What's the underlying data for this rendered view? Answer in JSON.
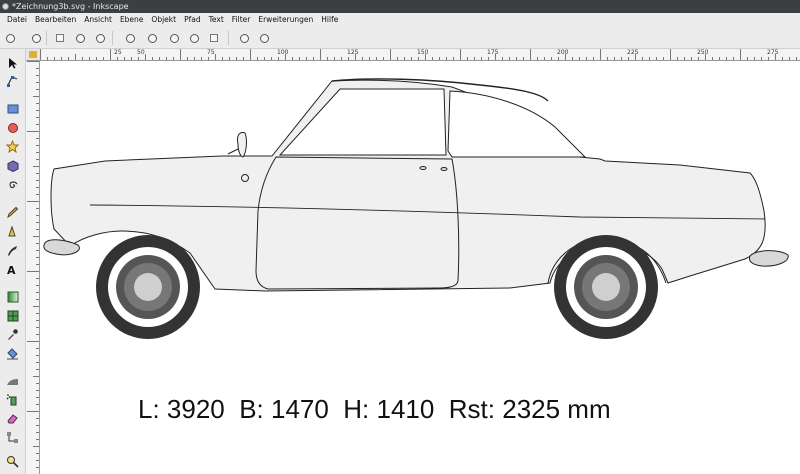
{
  "window": {
    "title": "*Zeichnung3b.svg - Inkscape"
  },
  "menu": {
    "items": [
      {
        "id": "datei",
        "label": "Datei"
      },
      {
        "id": "bearbeiten",
        "label": "Bearbeiten"
      },
      {
        "id": "ansicht",
        "label": "Ansicht"
      },
      {
        "id": "ebene",
        "label": "Ebene"
      },
      {
        "id": "objekt",
        "label": "Objekt"
      },
      {
        "id": "pfad",
        "label": "Pfad"
      },
      {
        "id": "text",
        "label": "Text"
      },
      {
        "id": "filter",
        "label": "Filter"
      },
      {
        "id": "erweiterungen",
        "label": "Erweiterungen"
      },
      {
        "id": "hilfe",
        "label": "Hilfe"
      }
    ]
  },
  "ruler": {
    "top_labels": [
      "25",
      "50",
      "75",
      "100",
      "125",
      "150",
      "175",
      "200",
      "225",
      "250",
      "275"
    ]
  },
  "toolbox": {
    "tools": [
      "selector-icon",
      "node-editor-icon",
      "rectangle-icon",
      "ellipse-icon",
      "star-icon",
      "3d-box-icon",
      "spiral-icon",
      "pencil-icon",
      "pen-icon",
      "calligraphy-icon",
      "text-icon",
      "gradient-icon",
      "mesh-icon",
      "dropper-icon",
      "paint-bucket-icon",
      "tweak-icon",
      "spray-icon",
      "eraser-icon",
      "connector-icon",
      "zoom-icon"
    ]
  },
  "canvas": {
    "dimensions_text": "L: 3920  B: 1470  H: 1410  Rst: 2325 mm",
    "car": {
      "body_fill": "#f0f0f0",
      "outline": "#222222",
      "tire": "#333333",
      "hub": "#cfcfcf"
    }
  }
}
